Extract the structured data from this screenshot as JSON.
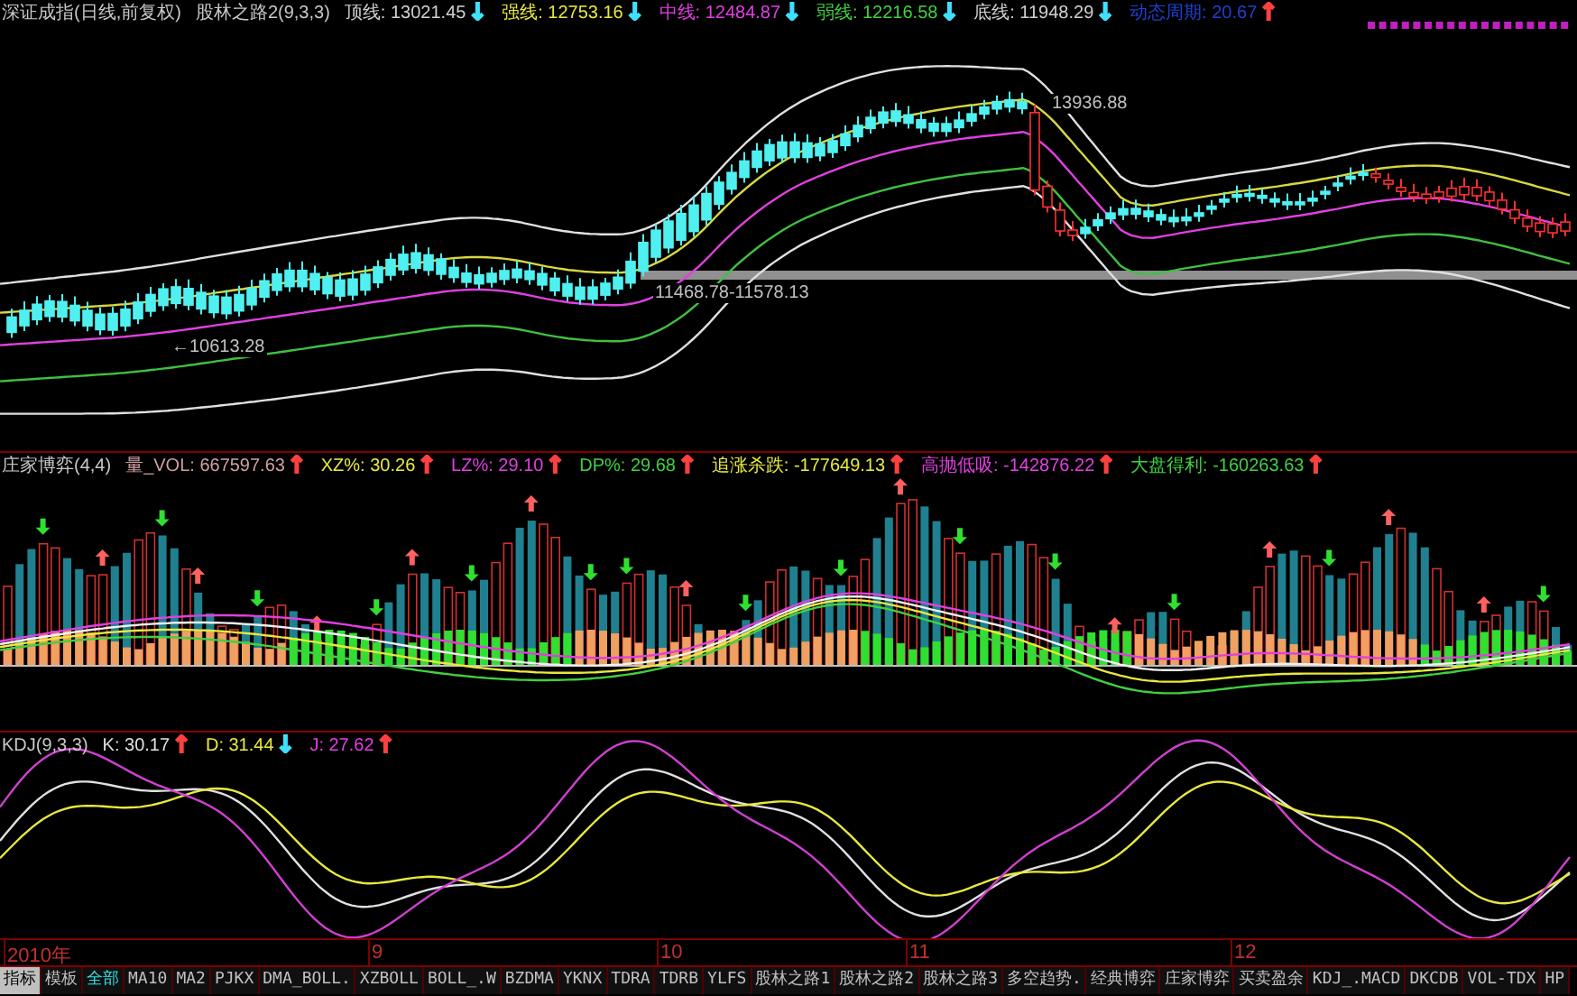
{
  "main_panel": {
    "title": "深证成指(日线,前复权)",
    "indicator": "股林之路2(9,3,3)",
    "readouts": [
      {
        "label": "顶线:",
        "value": "13021.45",
        "arrow": {
          "symbol": "↓",
          "color": "#40e0ff"
        },
        "color": "#d0d0d0"
      },
      {
        "label": "强线:",
        "value": "12753.16",
        "arrow": {
          "symbol": "↓",
          "color": "#40e0ff"
        },
        "color": "#e8e840"
      },
      {
        "label": "中线:",
        "value": "12484.87",
        "arrow": {
          "symbol": "↓",
          "color": "#40e0ff"
        },
        "color": "#e040e0"
      },
      {
        "label": "弱线:",
        "value": "12216.58",
        "arrow": {
          "symbol": "↓",
          "color": "#40e0ff"
        },
        "color": "#40d040"
      },
      {
        "label": "底线:",
        "value": "11948.29",
        "arrow": {
          "symbol": "↓",
          "color": "#40e0ff"
        },
        "color": "#d0d0d0"
      },
      {
        "label": "动态周期:",
        "value": "20.67",
        "arrow": {
          "symbol": "↑",
          "color": "#ff4040"
        },
        "color": "#2040d0"
      }
    ],
    "annotations": [
      "13936.88",
      "11468.78-11578.13",
      "←10613.28"
    ]
  },
  "volume_panel": {
    "title": "庄家博弈(4,4)",
    "readouts": [
      {
        "label": "量_VOL:",
        "value": "667597.63",
        "arrow": {
          "symbol": "↑",
          "color": "#ff4040"
        },
        "color": "#d0a0a0"
      },
      {
        "label": "XZ%:",
        "value": "30.26",
        "arrow": {
          "symbol": "↑",
          "color": "#ff4040"
        },
        "color": "#e8e840"
      },
      {
        "label": "LZ%:",
        "value": "29.10",
        "arrow": {
          "symbol": "↑",
          "color": "#ff4040"
        },
        "color": "#e040e0"
      },
      {
        "label": "DP%:",
        "value": "29.68",
        "arrow": {
          "symbol": "↑",
          "color": "#ff4040"
        },
        "color": "#40d040"
      },
      {
        "label": "追涨杀跌:",
        "value": "-177649.13",
        "arrow": {
          "symbol": "↑",
          "color": "#ff4040"
        },
        "color": "#e8e840"
      },
      {
        "label": "高抛低吸:",
        "value": "-142876.22",
        "arrow": {
          "symbol": "↑",
          "color": "#ff4040"
        },
        "color": "#e040e0"
      },
      {
        "label": "大盘得利:",
        "value": "-160263.63",
        "arrow": {
          "symbol": "↑",
          "color": "#ff4040"
        },
        "color": "#40d040"
      }
    ]
  },
  "kdj_panel": {
    "title": "KDJ(9,3,3)",
    "readouts": [
      {
        "label": "K:",
        "value": "30.17",
        "arrow": {
          "symbol": "↑",
          "color": "#ff4040"
        },
        "color": "#e0e0e0"
      },
      {
        "label": "D:",
        "value": "31.44",
        "arrow": {
          "symbol": "↓",
          "color": "#40e0ff"
        },
        "color": "#e8e840"
      },
      {
        "label": "J:",
        "value": "27.62",
        "arrow": {
          "symbol": "↑",
          "color": "#ff4040"
        },
        "color": "#e040e0"
      }
    ]
  },
  "date_axis": [
    "2010年",
    "9",
    "10",
    "11",
    "12"
  ],
  "mode_tabs": [
    {
      "label": "指标",
      "selected": true
    },
    {
      "label": "模板",
      "selected": false
    }
  ],
  "indicator_tabs": [
    {
      "label": "全部",
      "selected": true
    },
    {
      "label": "MA10",
      "selected": false
    },
    {
      "label": "MA2",
      "selected": false
    },
    {
      "label": "PJKX",
      "selected": false
    },
    {
      "label": "DMA_BOLL.",
      "selected": false
    },
    {
      "label": "XZBOLL",
      "selected": false
    },
    {
      "label": "BOLL_.W",
      "selected": false
    },
    {
      "label": "BZDMA",
      "selected": false
    },
    {
      "label": "YKNX",
      "selected": false
    },
    {
      "label": "TDRA",
      "selected": false
    },
    {
      "label": "TDRB",
      "selected": false
    },
    {
      "label": "YLFS",
      "selected": false
    },
    {
      "label": "股林之路1",
      "selected": false
    },
    {
      "label": "股林之路2",
      "selected": false
    },
    {
      "label": "股林之路3",
      "selected": false
    },
    {
      "label": "多空趋势.",
      "selected": false
    },
    {
      "label": "经典博弈",
      "selected": false
    },
    {
      "label": "庄家博弈",
      "selected": false
    },
    {
      "label": "买卖盈余",
      "selected": false
    },
    {
      "label": "KDJ_.MACD",
      "selected": false
    },
    {
      "label": "DKCDB",
      "selected": false
    },
    {
      "label": "VOL-TDX",
      "selected": false
    },
    {
      "label": "HP",
      "selected": false
    }
  ]
}
